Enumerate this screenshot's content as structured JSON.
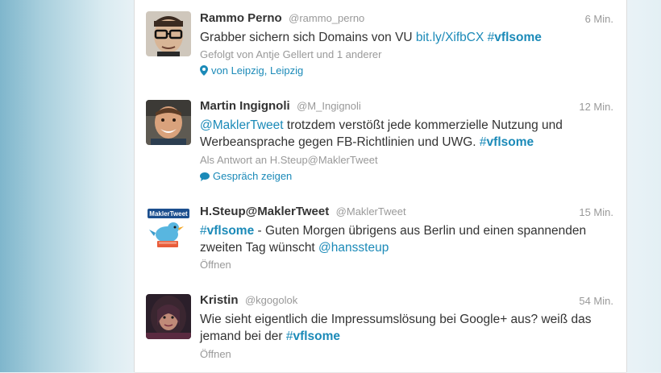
{
  "tweets": [
    {
      "name": "Rammo Perno",
      "handle": "@rammo_perno",
      "time": "6 Min.",
      "text_plain": "Grabber sichern sich Domains von VU ",
      "link": "bit.ly/XifbCX",
      "hashtag_hash": "#",
      "hashtag_word": "vflsome",
      "followed_by": "Gefolgt von Antje Gellert und 1 anderer",
      "location": "von Leipzig, Leipzig"
    },
    {
      "name": "Martin Ingignoli",
      "handle": "@M_Ingignoli",
      "time": "12 Min.",
      "mention": "@MaklerTweet",
      "text_plain": " trotzdem verstößt jede kommerzielle Nutzung und Werbeansprache gegen FB-Richtlinien und UWG. ",
      "hashtag_hash": "#",
      "hashtag_word": "vflsome",
      "reply_to": "Als Antwort an H.Steup@MaklerTweet",
      "conversation": "Gespräch zeigen"
    },
    {
      "name": "H.Steup@MaklerTweet",
      "handle": "@MaklerTweet",
      "time": "15 Min.",
      "hashtag_hash": "#",
      "hashtag_word": "vflsome",
      "text_plain": " - Guten Morgen übrigens aus Berlin und einen spannenden zweiten Tag wünscht ",
      "mention": "@hanssteup",
      "open": "Öffnen",
      "avatar_logo_text": "MaklerTweet"
    },
    {
      "name": "Kristin",
      "handle": "@kgogolok",
      "time": "54 Min.",
      "text_plain": "Wie sieht eigentlich die Impressumslösung bei Google+ aus? weiß das jemand bei der ",
      "hashtag_hash": "#",
      "hashtag_word": "vflsome",
      "open": "Öffnen"
    }
  ],
  "colors": {
    "link": "#1b8ab8",
    "text": "#333333",
    "muted": "#999999"
  }
}
